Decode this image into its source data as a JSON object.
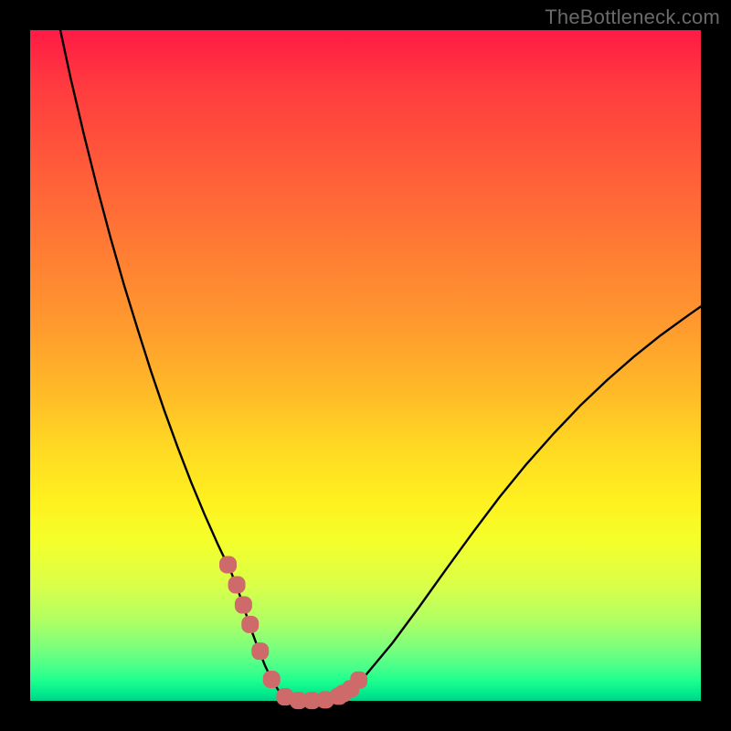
{
  "watermark": "TheBottleneck.com",
  "colors": {
    "background": "#000000",
    "curve": "#000000",
    "marker": "#cf6a6a",
    "gradient_top": "#ff1a45",
    "gradient_mid": "#ffe020",
    "gradient_bottom": "#00d088"
  },
  "chart_data": {
    "type": "line",
    "title": "",
    "xlabel": "",
    "ylabel": "",
    "xlim": [
      0,
      100
    ],
    "ylim": [
      0,
      100
    ],
    "grid": false,
    "legend": false,
    "series": [
      {
        "name": "bottleneck-curve",
        "x": [
          4.5,
          6,
          8,
          10,
          12,
          14,
          16,
          18,
          20,
          22,
          24,
          26,
          28,
          30,
          31,
          32,
          33,
          34,
          35,
          36,
          37,
          38,
          39,
          40,
          42,
          44,
          46,
          48,
          50,
          54,
          58,
          62,
          66,
          70,
          74,
          78,
          82,
          86,
          90,
          94,
          98,
          100
        ],
        "values": [
          100,
          93,
          84.5,
          76.5,
          69,
          62,
          55.5,
          49.2,
          43.3,
          37.8,
          32.6,
          27.8,
          23.3,
          19.1,
          16.5,
          13.5,
          10.5,
          7.8,
          5.3,
          3.2,
          1.6,
          0.6,
          0.15,
          0.05,
          0.05,
          0.15,
          0.7,
          1.9,
          3.8,
          8.6,
          14.0,
          19.6,
          25.1,
          30.4,
          35.3,
          39.8,
          44.0,
          47.8,
          51.3,
          54.5,
          57.4,
          58.8
        ]
      }
    ],
    "markers": {
      "name": "highlighted-points",
      "x": [
        29.5,
        30.8,
        31.8,
        32.8,
        34.3,
        36.0,
        38.0,
        40.0,
        42.0,
        44.0,
        46.0,
        46.7,
        47.8,
        49.0
      ],
      "values": [
        20.3,
        17.3,
        14.3,
        11.4,
        7.4,
        3.2,
        0.6,
        0.05,
        0.05,
        0.15,
        0.7,
        1.1,
        1.8,
        3.1
      ]
    }
  }
}
